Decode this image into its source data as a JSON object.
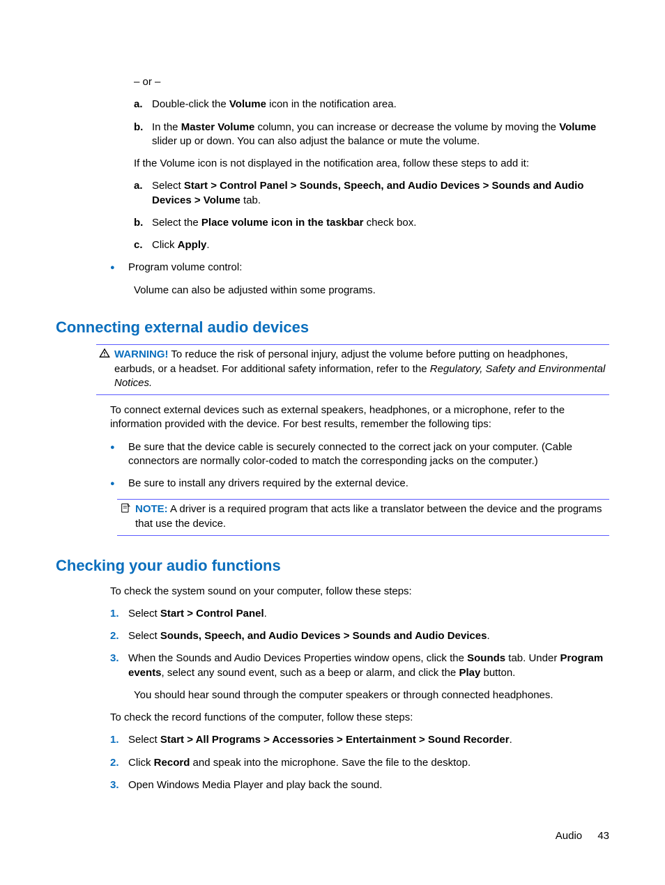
{
  "top": {
    "or_separator": "– or –",
    "steps_a": {
      "a": {
        "marker": "a.",
        "pre": "Double-click the ",
        "bold": "Volume",
        "post": " icon in the notification area."
      },
      "b": {
        "marker": "b.",
        "pre": "In the ",
        "b1": "Master Volume",
        "mid": " column, you can increase or decrease the volume by moving the ",
        "b2": "Volume",
        "post": " slider up or down. You can also adjust the balance or mute the volume."
      }
    },
    "no_icon_intro": "If the Volume icon is not displayed in the notification area, follow these steps to add it:",
    "steps_b": {
      "a": {
        "marker": "a.",
        "pre": "Select ",
        "bold": "Start > Control Panel > Sounds, Speech, and Audio Devices > Sounds and Audio Devices > Volume",
        "post": " tab."
      },
      "b": {
        "marker": "b.",
        "pre": "Select the ",
        "bold": "Place volume icon in the taskbar",
        "post": " check box."
      },
      "c": {
        "marker": "c.",
        "pre": "Click ",
        "bold": "Apply",
        "post": "."
      }
    },
    "bullet_item": "Program volume control:",
    "bullet_body": "Volume can also be adjusted within some programs."
  },
  "sec1": {
    "heading": "Connecting external audio devices",
    "warning": {
      "label": "WARNING!",
      "body_pre": "   To reduce the risk of personal injury, adjust the volume before putting on headphones, earbuds, or a headset. For additional safety information, refer to the ",
      "italic": "Regulatory, Safety and Environmental Notices.",
      "body_post": ""
    },
    "intro": "To connect external devices such as external speakers, headphones, or a microphone, refer to the information provided with the device. For best results, remember the following tips:",
    "bullets": {
      "b1": "Be sure that the device cable is securely connected to the correct jack on your computer. (Cable connectors are normally color-coded to match the corresponding jacks on the computer.)",
      "b2": "Be sure to install any drivers required by the external device."
    },
    "note": {
      "label": "NOTE:",
      "body": "   A driver is a required program that acts like a translator between the device and the programs that use the device."
    }
  },
  "sec2": {
    "heading": "Checking your audio functions",
    "intro": "To check the system sound on your computer, follow these steps:",
    "steps1": {
      "s1": {
        "marker": "1.",
        "pre": "Select ",
        "bold": "Start > Control Panel",
        "post": "."
      },
      "s2": {
        "marker": "2.",
        "pre": "Select ",
        "bold": "Sounds, Speech, and Audio Devices > Sounds and Audio Devices",
        "post": "."
      },
      "s3": {
        "marker": "3.",
        "pre": "When the Sounds and Audio Devices Properties window opens, click the ",
        "b1": "Sounds",
        "mid": " tab. Under ",
        "b2": "Program events",
        "mid2": ", select any sound event, such as a beep or alarm, and click the ",
        "b3": "Play",
        "post": " button."
      }
    },
    "should_hear": "You should hear sound through the computer speakers or through connected headphones.",
    "intro2": "To check the record functions of the computer, follow these steps:",
    "steps2": {
      "s1": {
        "marker": "1.",
        "pre": "Select ",
        "bold": "Start > All Programs > Accessories > Entertainment > Sound Recorder",
        "post": "."
      },
      "s2": {
        "marker": "2.",
        "pre": "Click ",
        "bold": "Record",
        "post": " and speak into the microphone. Save the file to the desktop."
      },
      "s3": {
        "marker": "3.",
        "text": "Open Windows Media Player and play back the sound."
      }
    }
  },
  "footer": {
    "section": "Audio",
    "page": "43"
  }
}
